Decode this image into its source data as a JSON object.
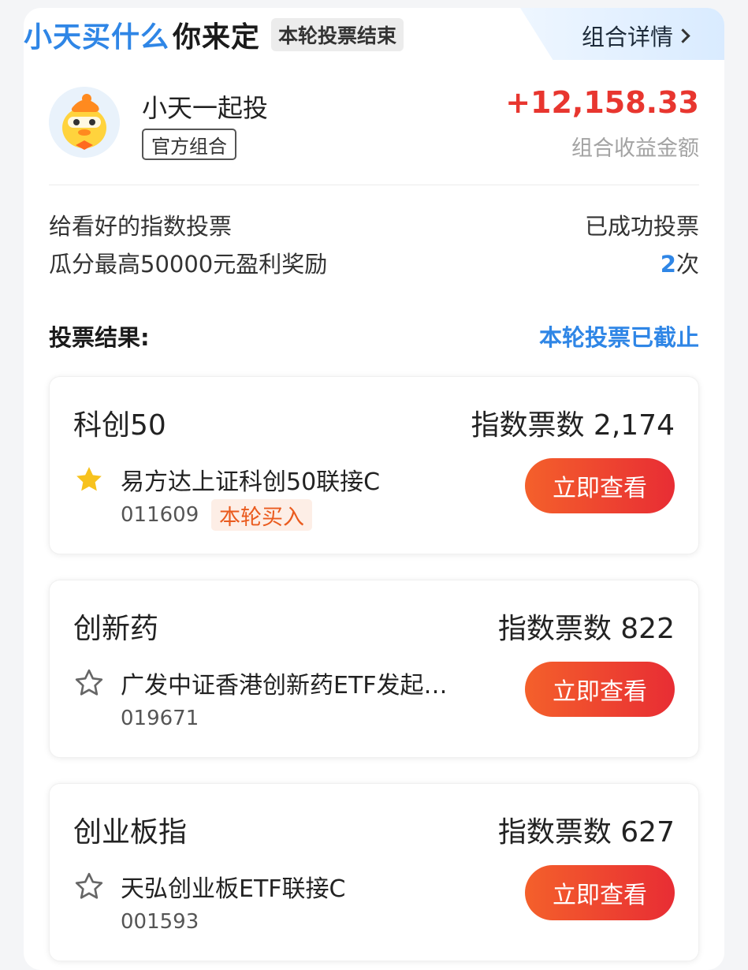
{
  "header": {
    "title_blue": "小天买什么",
    "title_dark": "你来定",
    "status_badge": "本轮投票结束",
    "detail_link": "组合详情"
  },
  "profile": {
    "name": "小天一起投",
    "badge": "官方组合",
    "profit_amount": "+12,158.33",
    "profit_label": "组合收益金额"
  },
  "intro": {
    "line1": "给看好的指数投票",
    "line2": "瓜分最高50000元盈利奖励",
    "voted_label": "已成功投票",
    "voted_count": "2",
    "voted_unit": "次"
  },
  "result": {
    "title": "投票结果:",
    "status": "本轮投票已截止"
  },
  "options": [
    {
      "name": "科创50",
      "votes_text": "指数票数 2,174",
      "fund": "易方达上证科创50联接C",
      "code": "011609",
      "tag": "本轮买入",
      "starred": true,
      "button": "立即查看"
    },
    {
      "name": "创新药",
      "votes_text": "指数票数 822",
      "fund": "广发中证香港创新药ETF发起…",
      "code": "019671",
      "starred": false,
      "button": "立即查看"
    },
    {
      "name": "创业板指",
      "votes_text": "指数票数 627",
      "fund": "天弘创业板ETF联接C",
      "code": "001593",
      "starred": false,
      "button": "立即查看"
    }
  ],
  "colors": {
    "accent_blue": "#2f86e6",
    "profit_red": "#e8362f",
    "button_gradient_start": "#f4602b",
    "button_gradient_end": "#e82d34",
    "tag_orange": "#ea5b1e",
    "star_gold": "#f7c21d"
  },
  "icons": {
    "detail_chevron": "chevron-right-icon",
    "starred": "star-filled-icon",
    "unstarred": "star-outline-icon",
    "avatar": "duck-mascot-avatar"
  }
}
